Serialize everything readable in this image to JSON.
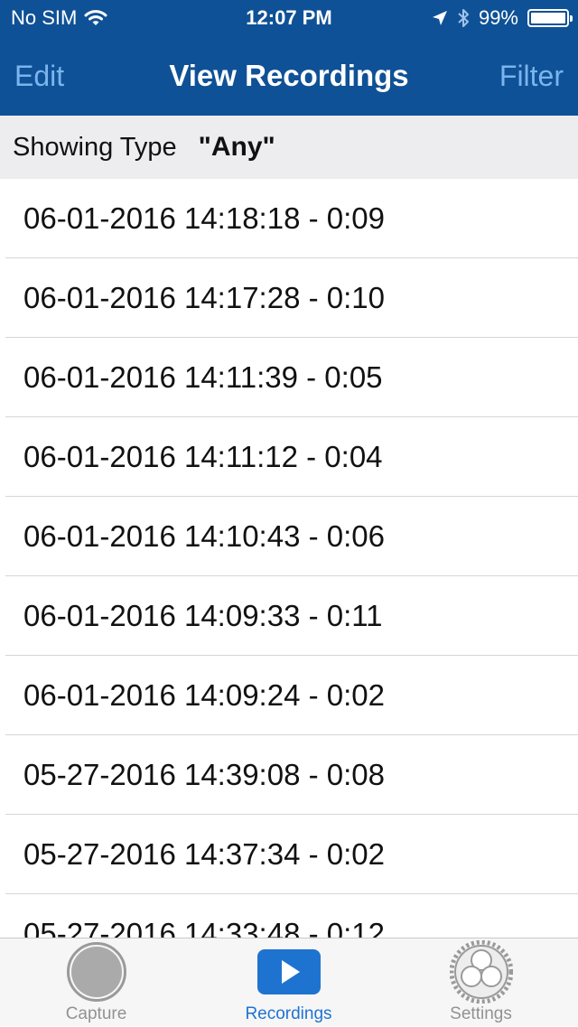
{
  "status_bar": {
    "carrier": "No SIM",
    "time": "12:07 PM",
    "battery": "99%",
    "battery_level": 0.99
  },
  "nav": {
    "left_button": "Edit",
    "title": "View Recordings",
    "right_button": "Filter"
  },
  "filter": {
    "label": "Showing Type",
    "value": "\"Any\""
  },
  "recordings": [
    "06-01-2016 14:18:18 - 0:09",
    "06-01-2016 14:17:28 - 0:10",
    "06-01-2016 14:11:39 - 0:05",
    "06-01-2016 14:11:12 - 0:04",
    "06-01-2016 14:10:43 - 0:06",
    "06-01-2016 14:09:33 - 0:11",
    "06-01-2016 14:09:24 - 0:02",
    "05-27-2016 14:39:08 - 0:08",
    "05-27-2016 14:37:34 - 0:02",
    "05-27-2016 14:33:48 - 0:12"
  ],
  "tabs": [
    {
      "label": "Capture",
      "icon": "record-circle-icon"
    },
    {
      "label": "Recordings",
      "icon": "play-icon",
      "active": true
    },
    {
      "label": "Settings",
      "icon": "gears-icon"
    }
  ],
  "colors": {
    "nav_background": "#0f5196",
    "nav_button": "#7bb4ee",
    "accent": "#1f73d0",
    "filter_bar_background": "#ededf0"
  }
}
